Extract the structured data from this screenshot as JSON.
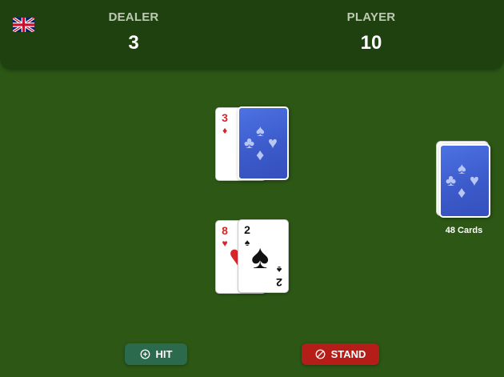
{
  "header": {
    "language_flag": "uk-flag-icon",
    "dealer": {
      "label": "DEALER",
      "score": "3"
    },
    "player": {
      "label": "PLAYER",
      "score": "10"
    }
  },
  "dealer_hand": [
    {
      "rank": "3",
      "suit": "♦",
      "suit_name": "diamonds",
      "color": "red",
      "face_up": true
    },
    {
      "face_up": false,
      "back_symbols": [
        "♠",
        "♣",
        "♥",
        "♦"
      ]
    }
  ],
  "player_hand": [
    {
      "rank": "8",
      "suit": "♥",
      "suit_name": "hearts",
      "color": "red",
      "face_up": true
    },
    {
      "rank": "2",
      "suit": "♠",
      "suit_name": "spades",
      "color": "black",
      "face_up": true
    }
  ],
  "deck": {
    "count_label": "48 Cards",
    "back_symbols": [
      "♠",
      "♣",
      "♥",
      "♦"
    ]
  },
  "actions": {
    "hit_label": "HIT",
    "hit_icon": "plus-circle-icon",
    "stand_label": "STAND",
    "stand_icon": "ban-icon"
  },
  "colors": {
    "table": "#2c5715",
    "scorebar": "#1f4110",
    "card_back": "#3b59c9",
    "hit_button": "#2c6a4d",
    "stand_button": "#b51d18",
    "red_suit": "#d6262c"
  }
}
